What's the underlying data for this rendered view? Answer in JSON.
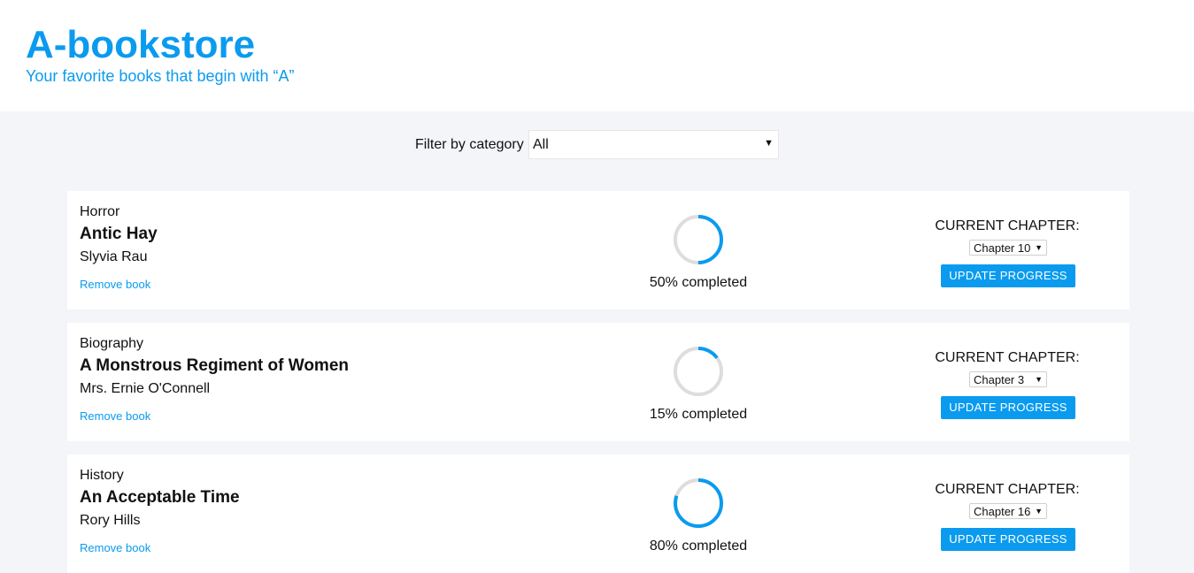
{
  "header": {
    "title": "A-bookstore",
    "tagline": "Your favorite books that begin with “A”"
  },
  "filter": {
    "label": "Filter by category",
    "selected": "All"
  },
  "books": [
    {
      "category": "Horror",
      "title": "Antic Hay",
      "author": "Slyvia Rau",
      "remove_label": "Remove book",
      "progress_percent": 50,
      "progress_text": "50% completed",
      "chapter_heading": "CURRENT CHAPTER:",
      "chapter_selected": "Chapter 10",
      "update_label": "UPDATE PROGRESS"
    },
    {
      "category": "Biography",
      "title": "A Monstrous Regiment of Women",
      "author": "Mrs. Ernie O'Connell",
      "remove_label": "Remove book",
      "progress_percent": 15,
      "progress_text": "15% completed",
      "chapter_heading": "CURRENT CHAPTER:",
      "chapter_selected": "Chapter 3",
      "update_label": "UPDATE PROGRESS"
    },
    {
      "category": "History",
      "title": "An Acceptable Time",
      "author": "Rory Hills",
      "remove_label": "Remove book",
      "progress_percent": 80,
      "progress_text": "80% completed",
      "chapter_heading": "CURRENT CHAPTER:",
      "chapter_selected": "Chapter 16",
      "update_label": "UPDATE PROGRESS"
    }
  ],
  "colors": {
    "accent": "#0a9bef",
    "ring_track": "#dddddd",
    "page_background": "#f4f5f9"
  },
  "icons": {
    "dropdown": "chevron-down-icon"
  }
}
